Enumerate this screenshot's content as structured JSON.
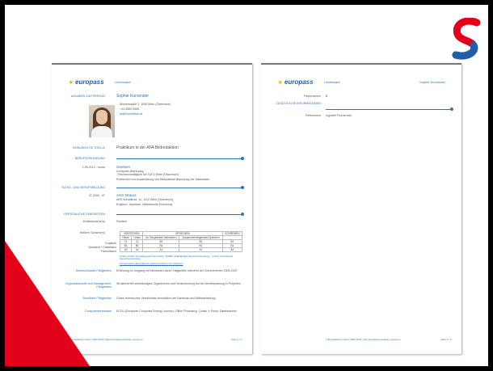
{
  "page1": {
    "logo_text": "europass",
    "doc_type": "Lebenslauf",
    "sections": {
      "personal_label": "ANGABEN ZUR PERSON",
      "name": "Sophie Kurvender",
      "address": "Musterstraße 2, 1090 Wien (Österreich)",
      "phone": "+43 5555 5555",
      "email": "sk@musterfrau.at",
      "position_label": "GEWÜNSCHTE STELLE",
      "position": "Praktikum in der AFA Bildredaktion",
      "experience_label": "BERUFSERFAHRUNG",
      "experience_date": "1.09.2013 - heute",
      "experience_title": "Geeleen",
      "experience_lines": [
        "Computer-Betreuung",
        "- Recherchetätigkeit bei TATO Wien (Österreich)",
        "Recherche und Ausarbeitung von Bildmaterial Betreuung der Datenbank"
      ],
      "education_label": "SCHUL- UND BERUFSBILDUNG",
      "education_date": "07.2009 - 07",
      "education_title": "AHS Matura",
      "education_lines": [
        "AHS Wendlinsd. 12, 1120 Wien (Österreich)",
        "Englisch, Spanisch, Bildnerische Erziehung"
      ],
      "skills_label": "PERSÖNLICHE FÄHIGKEITEN",
      "mother_tongue_label": "Muttersprache(n)",
      "mother_tongue": "Deutsch",
      "other_lang_label": "Weitere Sprache(n)",
      "lang_headers": [
        "VERSTEHEN",
        "SPRECHEN",
        "SCHREIBEN"
      ],
      "lang_subheaders": [
        "Hören",
        "Lesen",
        "An Gesprächen teilnehmen",
        "Zusammenhängendes Sprechen",
        ""
      ],
      "lang_rows": [
        {
          "lang": "Englisch",
          "levels": [
            "C1",
            "C1",
            "B2",
            "B2",
            "B2"
          ]
        },
        {
          "lang": "Spanisch / Castellano",
          "levels": [
            "B1",
            "B1",
            "B1",
            "B1",
            "B1"
          ]
        },
        {
          "lang": "Französisch",
          "levels": [
            "A2",
            "A2",
            "A2",
            "A2",
            "A2"
          ]
        }
      ],
      "lang_note": "Stufen: A1/A2: Grundlegende Kenntnisse - B1/B2: Selbständige Sprachverwendung - C1/C2: Kompetente Sprachverwendung",
      "lang_link": "Gemeinsamer Europäischer Referenzrahmen für Sprachen",
      "comm_label": "Kommunikative Fähigkeiten",
      "comm_text": "Erfahrung im Umgang mit Menschen durch Tätigkeiten während der Sommerferien 2005-2007",
      "org_label": "Organisatorische und Management-Fähigkeiten",
      "org_text": "Strukturiertes selbständiges Organisieren und Verantwortung bei der Arbeitsplanung in Projekten",
      "job_label": "Berufliche Fähigkeiten",
      "job_text": "Gutes technisches Verständnis hinsichtlich der Kameras und Bildbearbeitung",
      "digital_label": "Computerkenntnisse",
      "digital_text": "ECDL (European Computer Driving Licence): Office Photoshop, Quark X-Press, Datenbanken"
    },
    "footer": "© Europäische Union, 2002-2013 | http://europass.cedefop.europa.eu",
    "page_num": "Seite 1 / 2"
  },
  "page2": {
    "logo_text": "europass",
    "doc_type": "Lebenslauf",
    "header_name": "Sophie Kurvender",
    "license_label": "Führerschein",
    "license_value": "B",
    "additional_label": "ZUSÄTZLICHE INFORMATIONEN",
    "references_label": "Referenzen",
    "references_value": "Ingolder Fischernich",
    "footer": "© Europäische Union, 2002-2013 | http://europass.cedefop.europa.eu",
    "page_num": "Seite 2 / 2"
  },
  "colors": {
    "accent": "#2e72b8",
    "red": "#e2001a"
  }
}
